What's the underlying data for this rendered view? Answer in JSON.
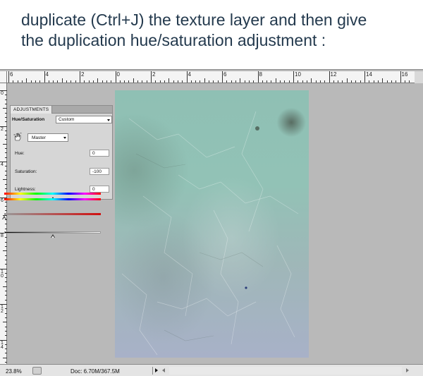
{
  "caption": {
    "line1": "duplicate (Ctrl+J) the texture layer and then give",
    "line2": "the duplication hue/saturation adjustment :"
  },
  "ruler_top_labels": [
    "6",
    "4",
    "2",
    "0",
    "2",
    "4",
    "6",
    "8",
    "10",
    "12",
    "14",
    "16"
  ],
  "ruler_left_labels": [
    "0",
    "2",
    "4",
    "6",
    "8",
    "10",
    "12",
    "14"
  ],
  "adjustments_panel": {
    "tab_label": "ADJUSTMENTS",
    "title": "Hue/Saturation",
    "preset": "Custom",
    "channel": "Master",
    "hue_label": "Hue:",
    "hue_value": "0",
    "saturation_label": "Saturation:",
    "saturation_value": "-100",
    "lightness_label": "Lightness:",
    "lightness_value": "0",
    "hue_level": 0.5,
    "saturation_level": 0.0,
    "lightness_level": 0.5
  },
  "status_bar": {
    "zoom": "23.8%",
    "doc_info": "Doc: 6.70M/367.5M"
  },
  "colors": {
    "caption_text": "#243a4e",
    "workspace": "#b9b9b9",
    "texture_top": "#8fc0b4",
    "texture_bottom": "#a8b1c8"
  },
  "icons": {
    "hand": "targeted-adjustment-hand-icon",
    "dropdown": "chevron-down-icon",
    "status_menu": "play-triangle-icon"
  }
}
